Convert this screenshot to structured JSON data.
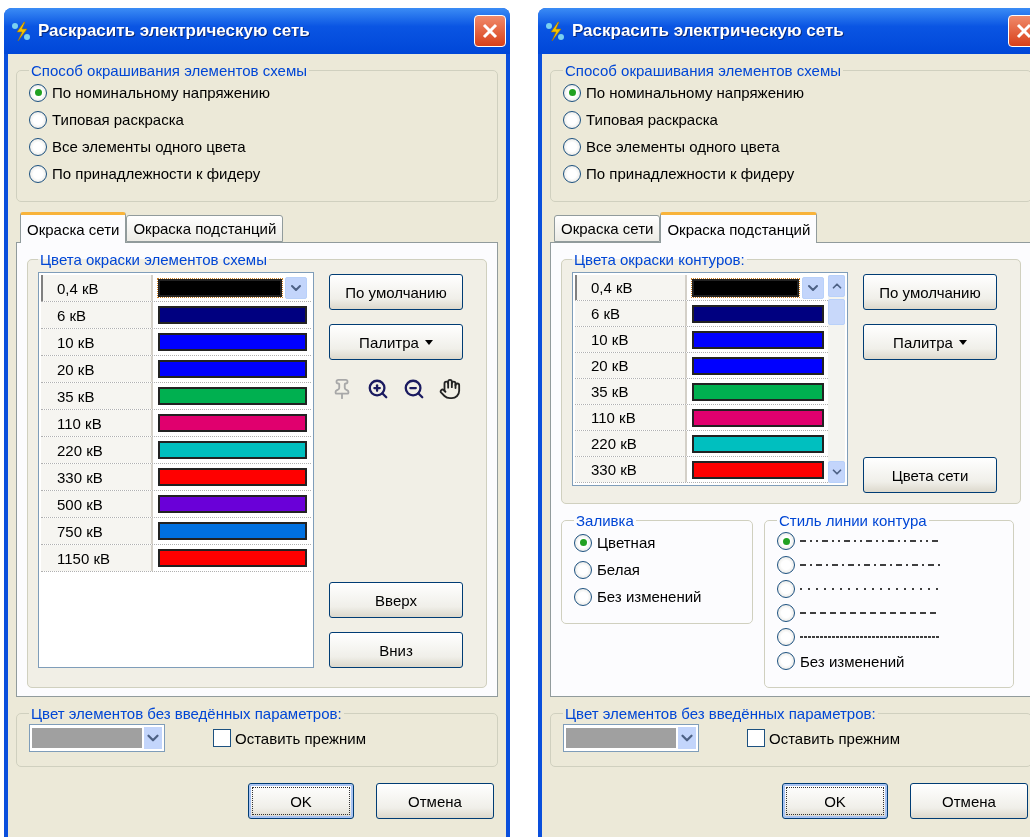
{
  "windows": [
    {
      "title": "Раскрасить электрическую сеть",
      "method": {
        "legend": "Способ окрашивания элементов схемы",
        "options": [
          {
            "label": "По номинальному напряжению",
            "selected": true
          },
          {
            "label": "Типовая раскраска",
            "selected": false
          },
          {
            "label": "Все элементы одного цвета",
            "selected": false
          },
          {
            "label": "По принадлежности к фидеру",
            "selected": false
          }
        ]
      },
      "tabs": [
        {
          "label": "Окраска сети",
          "selected": true
        },
        {
          "label": "Окраска подстанций",
          "selected": false
        }
      ],
      "panel": {
        "legend": "Цвета окраски элементов схемы",
        "scrollbar": false,
        "tools": true,
        "rows": [
          {
            "voltage": "0,4 кВ",
            "color": "#000000"
          },
          {
            "voltage": "6 кВ",
            "color": "#000080"
          },
          {
            "voltage": "10 кВ",
            "color": "#0000ff"
          },
          {
            "voltage": "20 кВ",
            "color": "#0000ff"
          },
          {
            "voltage": "35 кВ",
            "color": "#00b050"
          },
          {
            "voltage": "110 кВ",
            "color": "#e0006e"
          },
          {
            "voltage": "220 кВ",
            "color": "#00bfbf"
          },
          {
            "voltage": "330 кВ",
            "color": "#ff0000"
          },
          {
            "voltage": "500 кВ",
            "color": "#6a00d8"
          },
          {
            "voltage": "750 кВ",
            "color": "#0070e0"
          },
          {
            "voltage": "1150 кВ",
            "color": "#ff0000"
          }
        ],
        "top_buttons": [
          {
            "label": "По умолчанию",
            "kind": "plain"
          },
          {
            "label": "Палитра",
            "kind": "menu"
          }
        ],
        "bottom_buttons": [
          {
            "label": "Вверх",
            "kind": "plain"
          },
          {
            "label": "Вниз",
            "kind": "plain"
          }
        ]
      },
      "unset": {
        "legend": "Цвет элементов без введённых параметров:",
        "color": "#a0a0a0",
        "checkbox": {
          "label": "Оставить прежним",
          "checked": false
        }
      },
      "footer": [
        {
          "label": "OK",
          "kind": "default"
        },
        {
          "label": "Отмена",
          "kind": "plain"
        }
      ]
    },
    {
      "title": "Раскрасить электрическую сеть",
      "method": {
        "legend": "Способ окрашивания элементов схемы",
        "options": [
          {
            "label": "По номинальному напряжению",
            "selected": true
          },
          {
            "label": "Типовая раскраска",
            "selected": false
          },
          {
            "label": "Все элементы одного цвета",
            "selected": false
          },
          {
            "label": "По принадлежности к фидеру",
            "selected": false
          }
        ]
      },
      "tabs": [
        {
          "label": "Окраска сети",
          "selected": false
        },
        {
          "label": "Окраска подстанций",
          "selected": true
        }
      ],
      "panel": {
        "legend": "Цвета окраски контуров:",
        "scrollbar": true,
        "tools": false,
        "rows": [
          {
            "voltage": "0,4 кВ",
            "color": "#000000"
          },
          {
            "voltage": "6 кВ",
            "color": "#000080"
          },
          {
            "voltage": "10 кВ",
            "color": "#0000ff"
          },
          {
            "voltage": "20 кВ",
            "color": "#0000ff"
          },
          {
            "voltage": "35 кВ",
            "color": "#00b050"
          },
          {
            "voltage": "110 кВ",
            "color": "#e0006e"
          },
          {
            "voltage": "220 кВ",
            "color": "#00bfbf"
          },
          {
            "voltage": "330 кВ",
            "color": "#ff0000"
          }
        ],
        "top_buttons": [
          {
            "label": "По умолчанию",
            "kind": "plain"
          },
          {
            "label": "Палитра",
            "kind": "menu"
          }
        ],
        "bottom_buttons": [
          {
            "label": "Цвета сети",
            "kind": "plain"
          }
        ],
        "fill": {
          "legend": "Заливка",
          "options": [
            {
              "label": "Цветная",
              "selected": true
            },
            {
              "label": "Белая",
              "selected": false
            },
            {
              "label": "Без изменений",
              "selected": false
            }
          ]
        },
        "line_style": {
          "legend": "Стиль линии контура",
          "options": [
            {
              "kind": "dash-dot-dot",
              "selected": true
            },
            {
              "kind": "dash-dot",
              "selected": false
            },
            {
              "kind": "dot",
              "selected": false
            },
            {
              "kind": "dash",
              "selected": false
            },
            {
              "kind": "fine",
              "selected": false
            },
            {
              "kind": "text",
              "label": "Без изменений",
              "selected": false
            }
          ]
        }
      },
      "unset": {
        "legend": "Цвет элементов без введённых параметров:",
        "color": "#a0a0a0",
        "checkbox": {
          "label": "Оставить прежним",
          "checked": false
        }
      },
      "footer": [
        {
          "label": "OK",
          "kind": "default"
        },
        {
          "label": "Отмена",
          "kind": "plain"
        }
      ]
    }
  ]
}
